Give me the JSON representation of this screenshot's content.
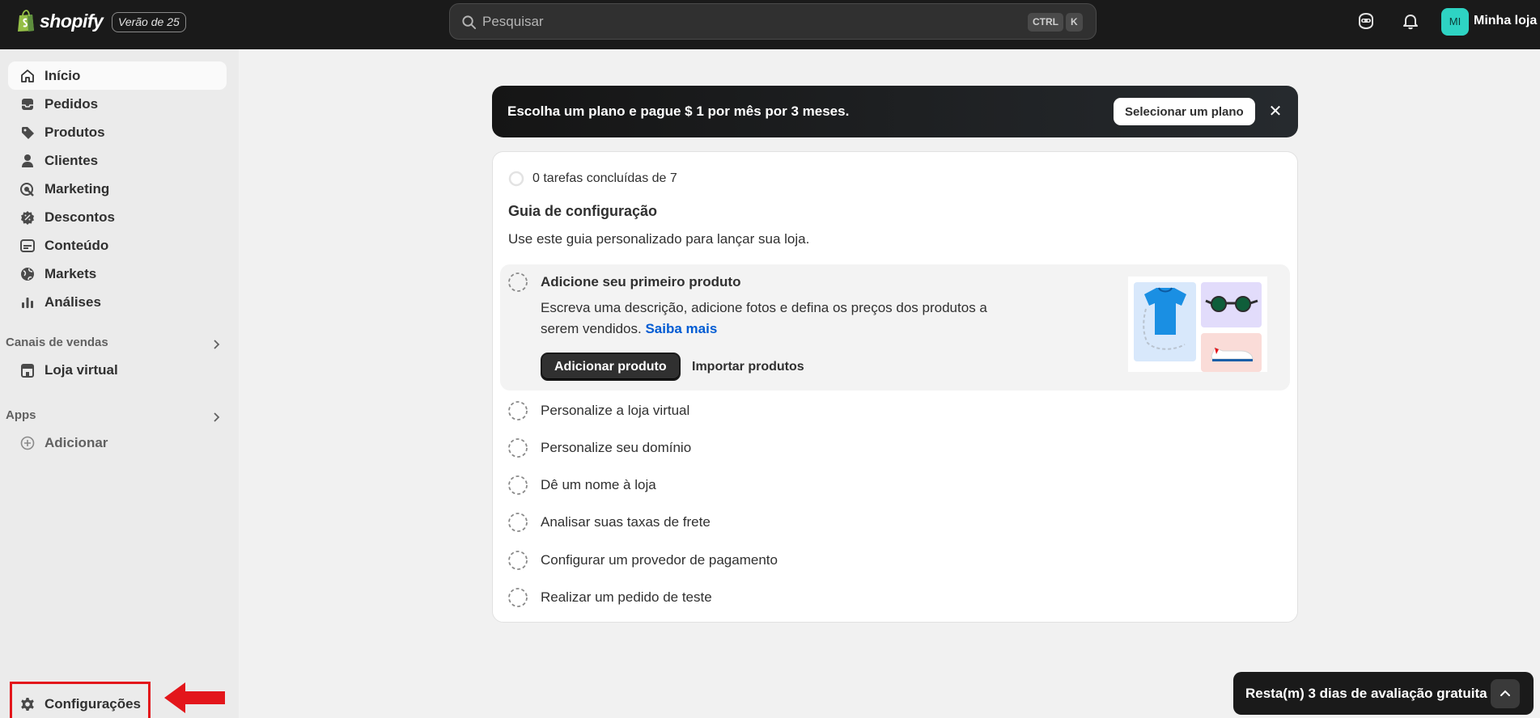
{
  "topbar": {
    "logo_text": "shopify",
    "edition_badge": "Verão de 25",
    "search_placeholder": "Pesquisar",
    "shortcut_ctrl": "CTRL",
    "shortcut_k": "K",
    "avatar_initials": "MI",
    "store_name": "Minha loja"
  },
  "sidebar": {
    "items": [
      {
        "label": "Início",
        "icon": "home-icon",
        "active": true
      },
      {
        "label": "Pedidos",
        "icon": "inbox-icon"
      },
      {
        "label": "Produtos",
        "icon": "tag-icon"
      },
      {
        "label": "Clientes",
        "icon": "person-icon"
      },
      {
        "label": "Marketing",
        "icon": "target-icon"
      },
      {
        "label": "Descontos",
        "icon": "discount-icon"
      },
      {
        "label": "Conteúdo",
        "icon": "image-icon"
      },
      {
        "label": "Markets",
        "icon": "globe-icon"
      },
      {
        "label": "Análises",
        "icon": "bar-chart-icon"
      }
    ],
    "sales_channels_label": "Canais de vendas",
    "online_store_label": "Loja virtual",
    "apps_label": "Apps",
    "add_label": "Adicionar",
    "settings_label": "Configurações"
  },
  "banner": {
    "text": "Escolha um plano e pague $ 1 por mês por 3 meses.",
    "button_label": "Selecionar um plano",
    "close_glyph": "✕"
  },
  "guide": {
    "progress_text": "0 tarefas concluídas de 7",
    "title": "Guia de configuração",
    "subtitle": "Use este guia personalizado para lançar sua loja.",
    "expanded_task": {
      "title": "Adicione seu primeiro produto",
      "description": "Escreva uma descrição, adicione fotos e defina os preços dos produtos a serem vendidos.",
      "link": "Saiba mais",
      "primary_button": "Adicionar produto",
      "secondary_button": "Importar produtos"
    },
    "tasks": [
      "Personalize a loja virtual",
      "Personalize seu domínio",
      "Dê um nome à loja",
      "Analisar suas taxas de frete",
      "Configurar um provedor de pagamento",
      "Realizar um pedido de teste"
    ]
  },
  "trial": {
    "text": "Resta(m) 3 dias de avaliação gratuita"
  },
  "colors": {
    "topbar": "#1a1a1a",
    "sidebar": "#ebebeb",
    "avatar": "#2ed3c3",
    "link": "#005bd3",
    "highlight": "#e3161b"
  }
}
